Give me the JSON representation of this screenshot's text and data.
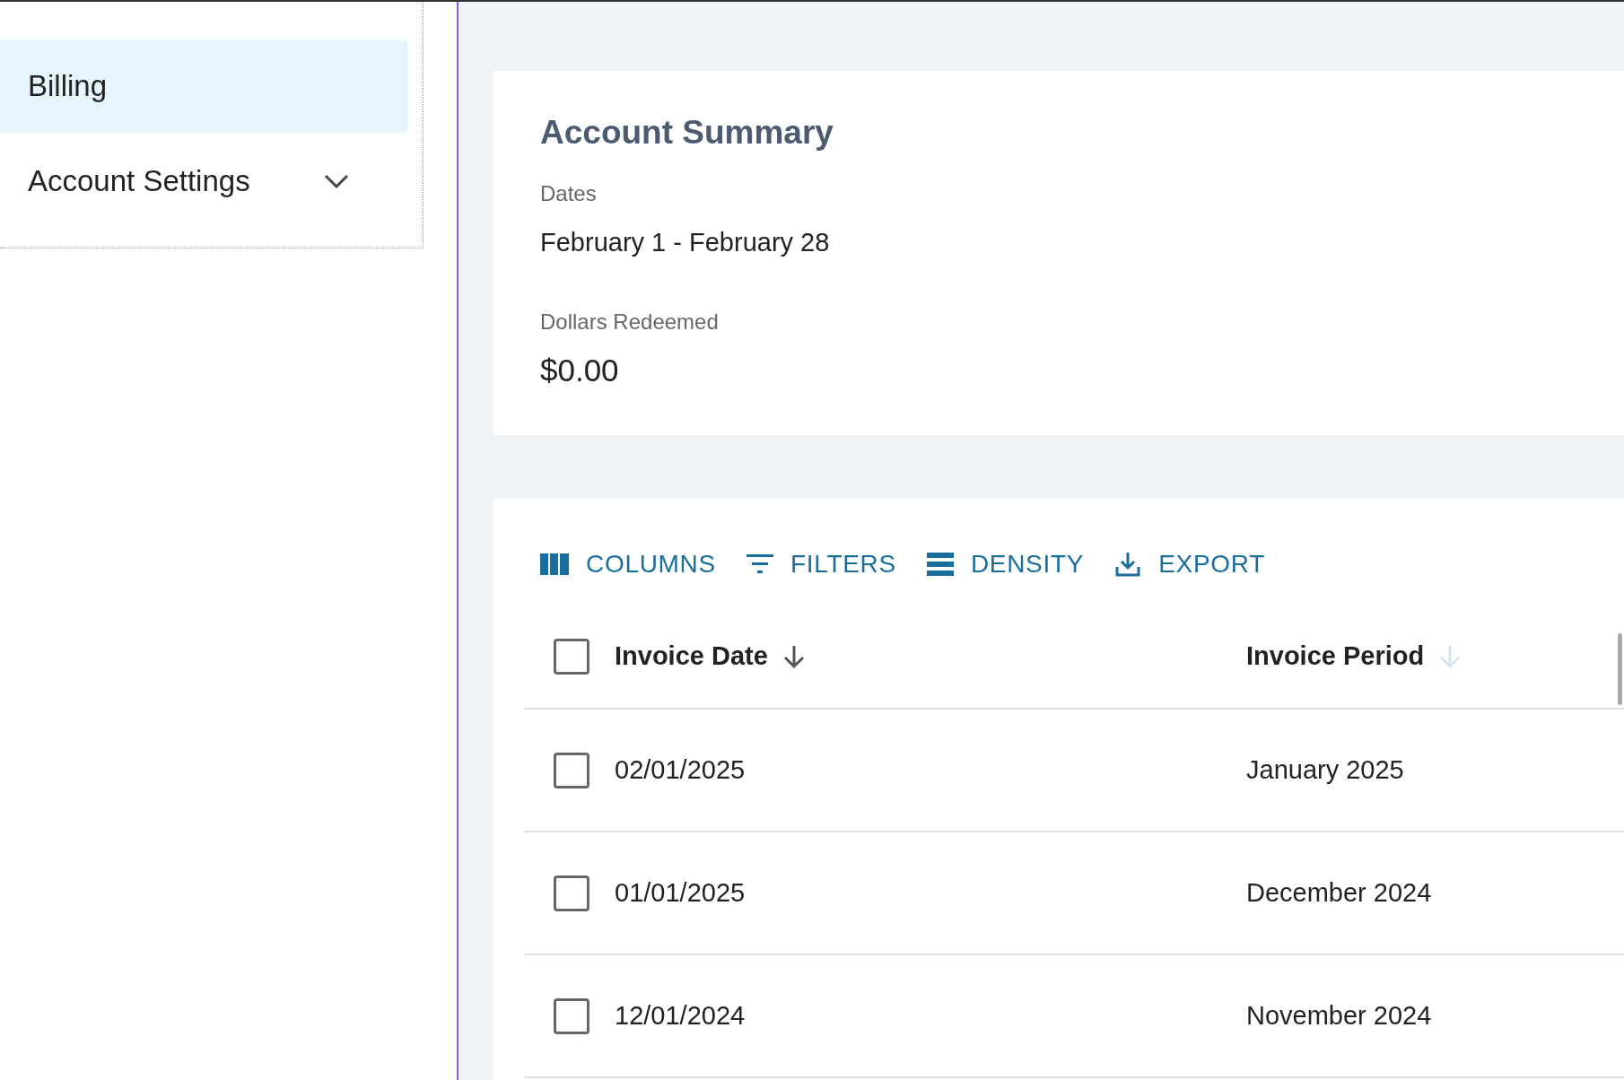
{
  "sidebar": {
    "items": [
      {
        "label": "Billing",
        "selected": true,
        "expandable": false
      },
      {
        "label": "Account Settings",
        "selected": false,
        "expandable": true
      }
    ]
  },
  "summary": {
    "title": "Account Summary",
    "fields": [
      {
        "label": "Dates",
        "value": "February 1 - February 28",
        "kind": "text"
      },
      {
        "label": "Dollars Redeemed",
        "value": "$0.00",
        "kind": "amount"
      }
    ]
  },
  "toolbar": [
    {
      "label": "COLUMNS",
      "kind": "columns"
    },
    {
      "label": "FILTERS",
      "kind": "filters"
    },
    {
      "label": "DENSITY",
      "kind": "density"
    },
    {
      "label": "EXPORT",
      "kind": "export"
    }
  ],
  "table": {
    "columns": [
      {
        "label": "Invoice Date",
        "sorted": true
      },
      {
        "label": "Invoice Period",
        "sorted": false
      }
    ],
    "select_all_checked": false,
    "rows": [
      {
        "checked": false,
        "cells": [
          "02/01/2025",
          "January 2025"
        ]
      },
      {
        "checked": false,
        "cells": [
          "01/01/2025",
          "December 2024"
        ]
      },
      {
        "checked": false,
        "cells": [
          "12/01/2024",
          "November 2024"
        ]
      }
    ]
  }
}
